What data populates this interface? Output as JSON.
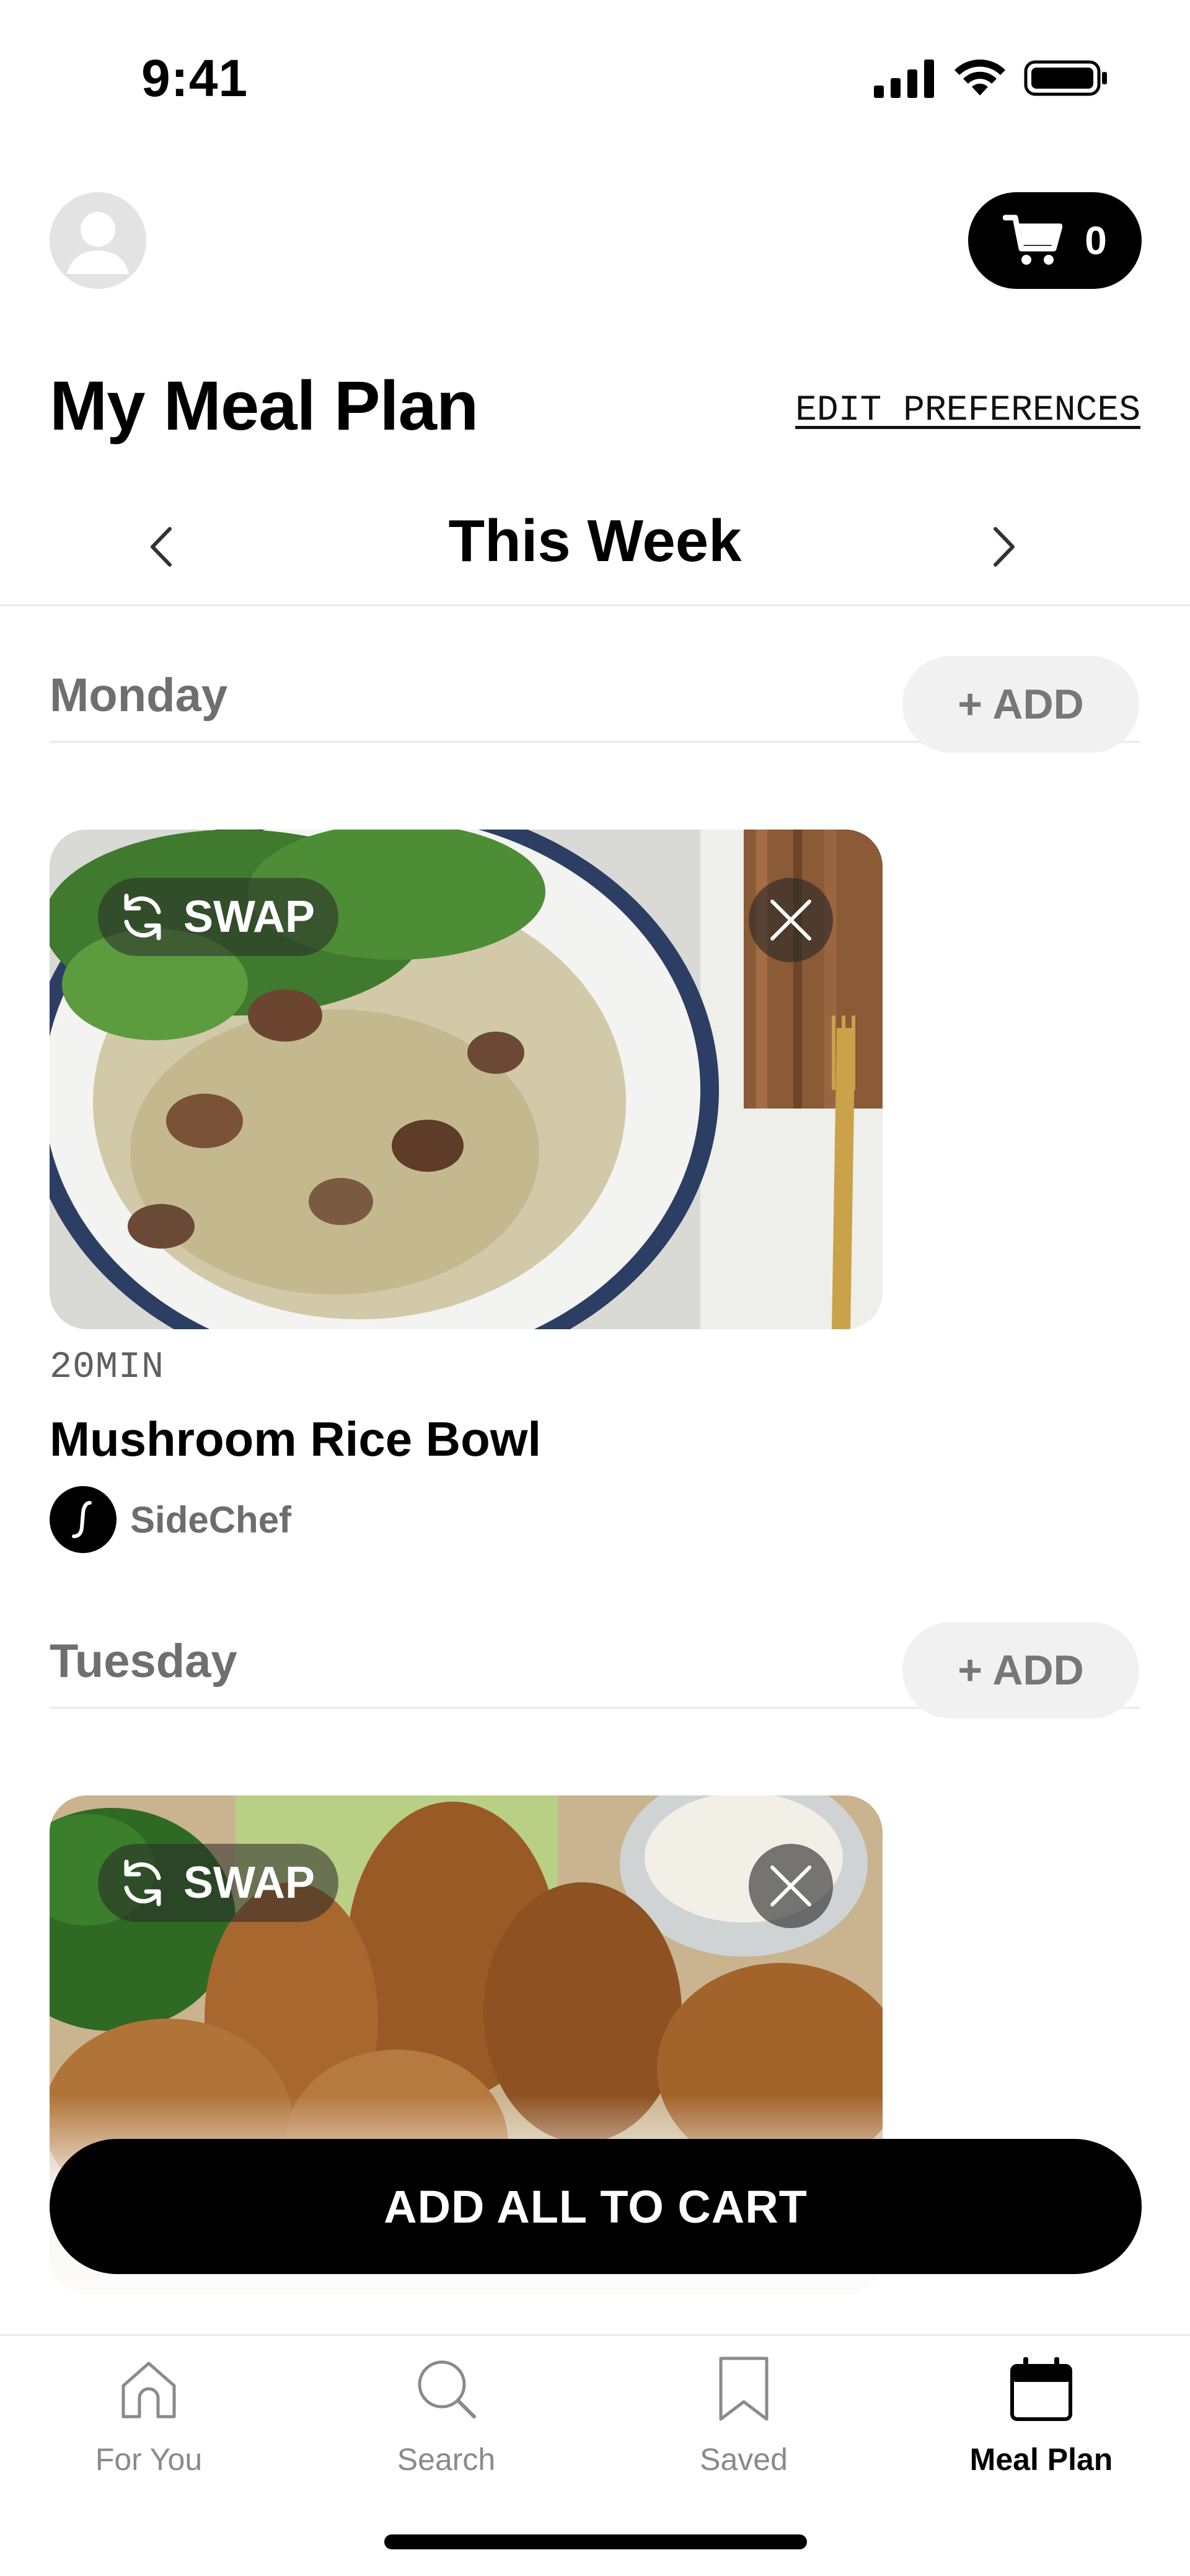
{
  "status_bar": {
    "time": "9:41"
  },
  "header": {
    "cart_count": "0",
    "title": "My Meal Plan",
    "edit_preferences_label": "EDIT PREFERENCES"
  },
  "week_nav": {
    "label": "This Week"
  },
  "days": [
    {
      "name": "Monday",
      "add_label": "+ ADD",
      "meal": {
        "swap_label": "SWAP",
        "time": "20MIN",
        "title": "Mushroom Rice Bowl",
        "source": "SideChef"
      }
    },
    {
      "name": "Tuesday",
      "add_label": "+ ADD",
      "meal": {
        "swap_label": "SWAP"
      }
    }
  ],
  "cta": {
    "add_all_label": "ADD ALL TO CART"
  },
  "tabs": [
    {
      "label": "For You",
      "icon": "home-icon"
    },
    {
      "label": "Search",
      "icon": "search-icon"
    },
    {
      "label": "Saved",
      "icon": "bookmark-icon"
    },
    {
      "label": "Meal Plan",
      "icon": "calendar-icon",
      "active": true
    }
  ],
  "colors": {
    "primary": "#000000",
    "muted": "#6f6f6f",
    "chip_bg": "#f1f1f1",
    "divider": "#ebebeb"
  }
}
